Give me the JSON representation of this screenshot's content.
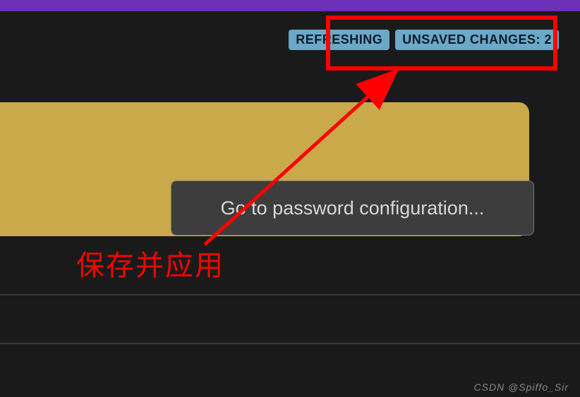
{
  "badges": {
    "refreshing": "REFRESHING",
    "unsaved_changes": "UNSAVED CHANGES: 2"
  },
  "tooltip": {
    "text": "Go to password configuration..."
  },
  "annotations": {
    "chinese_label": "保存并应用"
  },
  "watermark": {
    "text": "CSDN @Spiffo_Sir"
  }
}
